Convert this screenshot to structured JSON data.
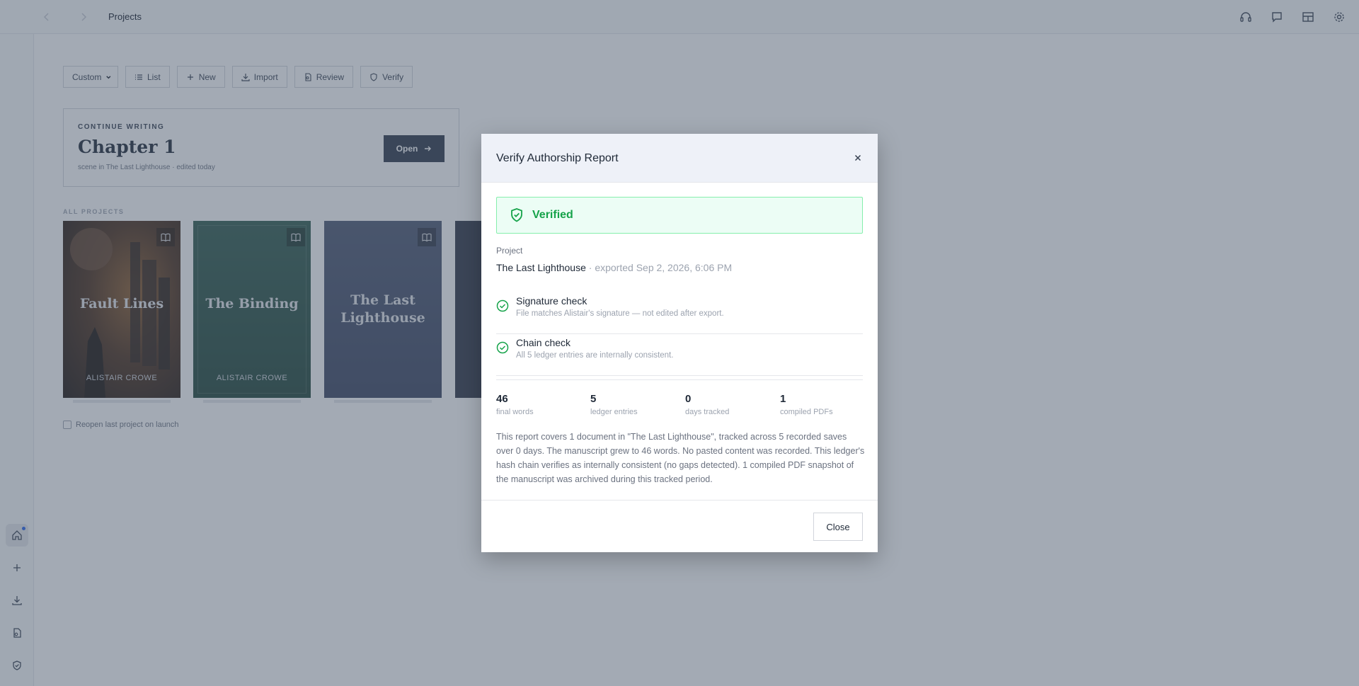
{
  "topbar": {
    "title": "Projects",
    "icons": [
      "headphones-icon",
      "chat-icon",
      "layout-icon",
      "settings-icon"
    ]
  },
  "rail": {
    "items": [
      "home-icon",
      "plus-icon",
      "download-icon",
      "file-icon",
      "shield-icon"
    ]
  },
  "toolbar": {
    "view_select": "Custom",
    "list_label": "List",
    "new_label": "New",
    "import_label": "Import",
    "review_label": "Review",
    "verify_label": "Verify"
  },
  "continue": {
    "kicker": "CONTINUE WRITING",
    "title": "Chapter 1",
    "subtitle": "scene in The Last Lighthouse · edited today",
    "open_label": "Open"
  },
  "projects": {
    "section_label": "ALL PROJECTS",
    "books": [
      {
        "title": "Fault Lines",
        "author": "ALISTAIR CROWE"
      },
      {
        "title": "The Binding",
        "author": "ALISTAIR CROWE"
      },
      {
        "title": "The Last Lighthouse",
        "author": ""
      }
    ],
    "reopen_label": "Reopen last project on launch"
  },
  "modal": {
    "title": "Verify Authorship Report",
    "status": "Verified",
    "project_label": "Project",
    "project_name": "The Last Lighthouse",
    "project_meta": " · exported Sep 2, 2026, 6:06 PM",
    "checks": [
      {
        "title": "Signature check",
        "desc": "File matches Alistair's signature — not edited after export."
      },
      {
        "title": "Chain check",
        "desc": "All 5 ledger entries are internally consistent."
      }
    ],
    "stats": [
      {
        "value": "46",
        "label": "final words"
      },
      {
        "value": "5",
        "label": "ledger entries"
      },
      {
        "value": "0",
        "label": "days tracked"
      },
      {
        "value": "1",
        "label": "compiled PDFs"
      }
    ],
    "summary": "This report covers 1 document in \"The Last Lighthouse\", tracked across 5 recorded saves over 0 days. The manuscript grew to 46 words. No pasted content was recorded. This ledger's hash chain verifies as internally consistent (no gaps detected). 1 compiled PDF snapshot of the manuscript was archived during this tracked period.",
    "close_label": "Close"
  },
  "colors": {
    "accent_dark": "#2d3748",
    "success": "#16a34a",
    "success_bg": "#ecfdf5",
    "overlay": "#475569"
  }
}
